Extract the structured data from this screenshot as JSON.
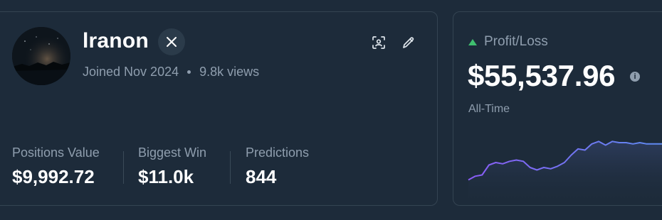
{
  "profile": {
    "username": "lranon",
    "social_icon": "x-logo-icon",
    "joined": "Joined Nov 2024",
    "views": "9.8k views",
    "actions": [
      "scan-icon",
      "pencil-icon"
    ]
  },
  "stats": [
    {
      "label": "Positions Value",
      "value": "$9,992.72"
    },
    {
      "label": "Biggest Win",
      "value": "$11.0k"
    },
    {
      "label": "Predictions",
      "value": "844"
    }
  ],
  "pnl": {
    "label": "Profit/Loss",
    "value": "$55,537.96",
    "period": "All-Time",
    "trend_icon": "triangle-up-icon",
    "colors": {
      "up": "#3fbf6f",
      "line_start": "#8a5cf6",
      "line_end": "#5b8def"
    }
  },
  "chart_data": {
    "type": "line",
    "title": "",
    "xlabel": "",
    "ylabel": "",
    "x": [
      0,
      1,
      2,
      3,
      4,
      5,
      6,
      7,
      8,
      9,
      10,
      11,
      12,
      13,
      14,
      15,
      16,
      17,
      18,
      19,
      20,
      21,
      22,
      23,
      24,
      25,
      26,
      27,
      28,
      29,
      30
    ],
    "series": [
      {
        "values": [
          2,
          5,
          6,
          14,
          16,
          15,
          17,
          18,
          17,
          12,
          10,
          12,
          11,
          13,
          16,
          22,
          27,
          26,
          31,
          33,
          30,
          33,
          32,
          32,
          31,
          32,
          31,
          31,
          31,
          31,
          31
        ]
      }
    ],
    "ylim": [
      0,
      40
    ],
    "grid": false,
    "legend": "none"
  }
}
